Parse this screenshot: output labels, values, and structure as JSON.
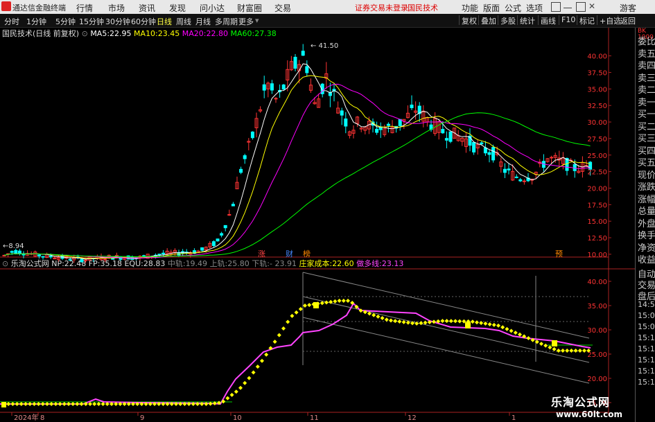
{
  "app": {
    "title": "通达信金融终端",
    "menus": [
      "行情",
      "市场",
      "资讯",
      "发现",
      "问小达",
      "财富圈",
      "交易"
    ],
    "warning": "证券交易未登录",
    "stock_name": "国民技术",
    "right_menus": [
      "功能",
      "版面",
      "公式",
      "选项"
    ],
    "user": "游客"
  },
  "toolbar": {
    "periods": [
      "分时",
      "1分钟",
      "5分钟",
      "15分钟",
      "30分钟",
      "60分钟",
      "日线",
      "周线",
      "月线",
      "多周期",
      "更多"
    ],
    "active_period": "日线",
    "right_tools": [
      "复权",
      "叠加",
      "多股",
      "统计",
      "画线",
      "F10",
      "标记",
      "+自选",
      "返回"
    ]
  },
  "main_chart": {
    "header": "国民技术(日线 前复权)",
    "ma": [
      {
        "label": "MA5:",
        "value": "22.95",
        "color": "#ffffff"
      },
      {
        "label": "MA10:",
        "value": "23.45",
        "color": "#ffff00"
      },
      {
        "label": "MA20:",
        "value": "22.80",
        "color": "#ff00ff"
      },
      {
        "label": "MA60:",
        "value": "27.38",
        "color": "#00ff00"
      }
    ],
    "high_label": "41.50",
    "low_label": "8.94",
    "y_ticks": [
      "40.00",
      "37.50",
      "35.00",
      "32.50",
      "30.00",
      "27.50",
      "25.00",
      "22.50",
      "20.00",
      "17.50",
      "15.00",
      "12.50",
      "10.00"
    ],
    "markers": [
      {
        "text": "涨",
        "color": "#ff4444"
      },
      {
        "text": "财",
        "color": "#4488ff"
      },
      {
        "text": "榜",
        "color": "#ff8800"
      },
      {
        "text": "预",
        "color": "#ff8800"
      }
    ]
  },
  "sub_chart": {
    "header": "乐淘公式网",
    "indicators": [
      {
        "label": "NP:",
        "value": "22.48",
        "color": "#dddddd"
      },
      {
        "label": "FP:",
        "value": "35.18",
        "color": "#dddddd"
      },
      {
        "label": "EQU:",
        "value": "28.83",
        "color": "#dddddd"
      },
      {
        "label": "中轨:",
        "value": "19.49",
        "color": "#888888"
      },
      {
        "label": "上轨:",
        "value": "25.80",
        "color": "#888888"
      },
      {
        "label": "下轨:",
        "value": "- 23.91",
        "color": "#888888"
      },
      {
        "label": "庄家成本:",
        "value": "22.60",
        "color": "#ffff00"
      },
      {
        "label": "做多线:",
        "value": "23.13",
        "color": "#ff44ff"
      }
    ],
    "y_ticks": [
      "40.00",
      "35.00",
      "30.00",
      "25.00",
      "20.00",
      "15.00"
    ]
  },
  "x_axis": [
    "2024年",
    "8",
    "9",
    "10",
    "11",
    "12",
    "1"
  ],
  "right_panel": {
    "top_label": "BK 1000",
    "items": [
      "委比",
      "卖五",
      "卖四",
      "卖三",
      "卖二",
      "卖一",
      "买一",
      "买二",
      "买三",
      "买四",
      "买五",
      "现价",
      "涨跌",
      "涨幅",
      "总量",
      "外盘",
      "换手",
      "净资",
      "收益"
    ],
    "items2": [
      "自动",
      "交易",
      "盘后",
      "14:57",
      "15:00",
      "15:05",
      "15:12",
      "15:13",
      "15:15",
      "15:16",
      "15:17"
    ]
  },
  "watermark": {
    "line1": "乐淘公式网",
    "line2": "www.60lt.com"
  },
  "colors": {
    "up": "#ff3333",
    "down": "#00ffff",
    "ma5": "#ffffff",
    "ma10": "#ffff00",
    "ma20": "#ff00ff",
    "ma60": "#00ff00",
    "axis": "#aa2222"
  }
}
